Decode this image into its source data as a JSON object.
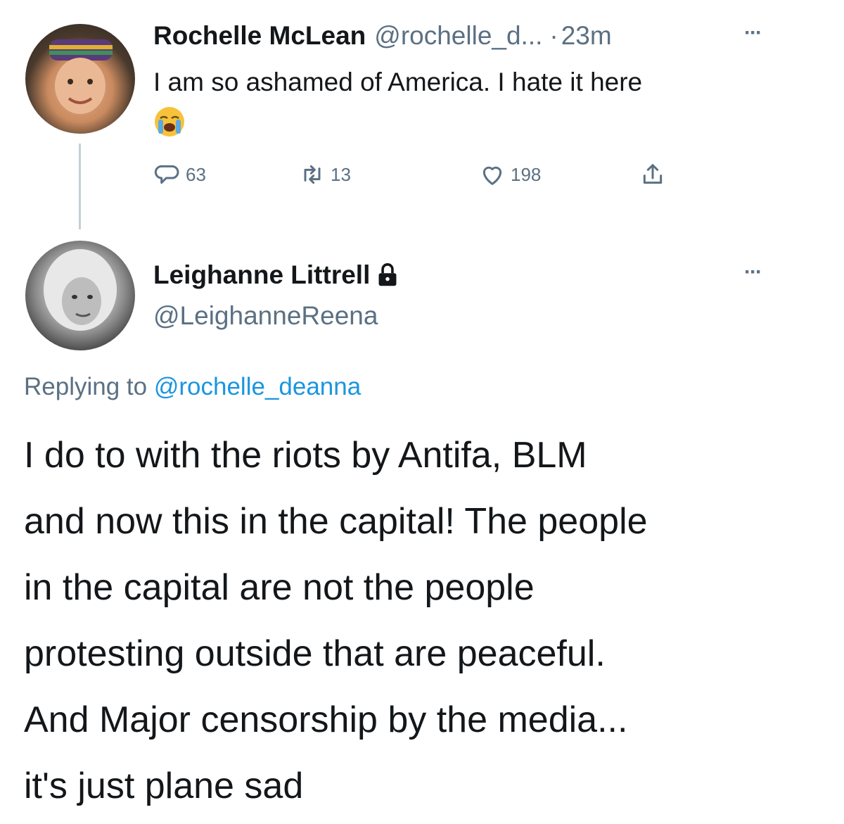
{
  "tweet1": {
    "name": "Rochelle McLean",
    "handle": "@rochelle_d...",
    "dot": "·",
    "time": "23m",
    "more": "···",
    "text": "I am so ashamed of America. I hate it here",
    "emoji": "loudly-crying-face",
    "actions": {
      "replies": "63",
      "retweets": "13",
      "likes": "198"
    },
    "avatar": "profile-photo"
  },
  "tweet2": {
    "name": "Leighanne Littrell",
    "handle": "@LeighanneReena",
    "more": "···",
    "protected_icon": "lock-icon",
    "replying_prefix": "Replying to",
    "replying_to": "@rochelle_deanna",
    "body_lines": [
      "I do to with the riots by Antifa, BLM",
      "and now this in the capital! The people",
      "in the capital are not the people",
      "protesting outside that are peaceful.",
      "And Major censorship by the media...",
      "it's just plane sad"
    ],
    "avatar": "profile-photo"
  },
  "colors": {
    "text": "#14171a",
    "secondary": "#5b7083",
    "link": "#1b95e0",
    "thread_line": "#c4cfd6"
  }
}
